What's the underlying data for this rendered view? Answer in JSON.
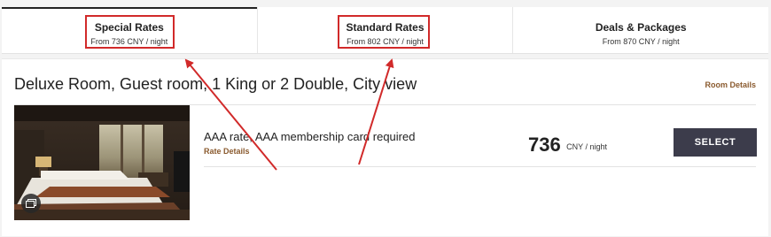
{
  "tabs": [
    {
      "name": "Special Rates",
      "price": "From 736 CNY / night",
      "active": true
    },
    {
      "name": "Standard Rates",
      "price": "From 802 CNY / night",
      "active": false
    },
    {
      "name": "Deals & Packages",
      "price": "From 870 CNY / night",
      "active": false
    }
  ],
  "room": {
    "title": "Deluxe Room, Guest room, 1 King or 2 Double, City view",
    "details_link": "Room Details",
    "photo_icon": "gallery-icon"
  },
  "rate": {
    "name": "AAA rate, AAA membership card required",
    "details_link": "Rate Details",
    "price": "736",
    "unit": "CNY / night",
    "select_label": "SELECT"
  },
  "colors": {
    "accent_link": "#8a5a2e",
    "select_button": "#3c3c4b",
    "annotation_red": "#d12a2a"
  }
}
